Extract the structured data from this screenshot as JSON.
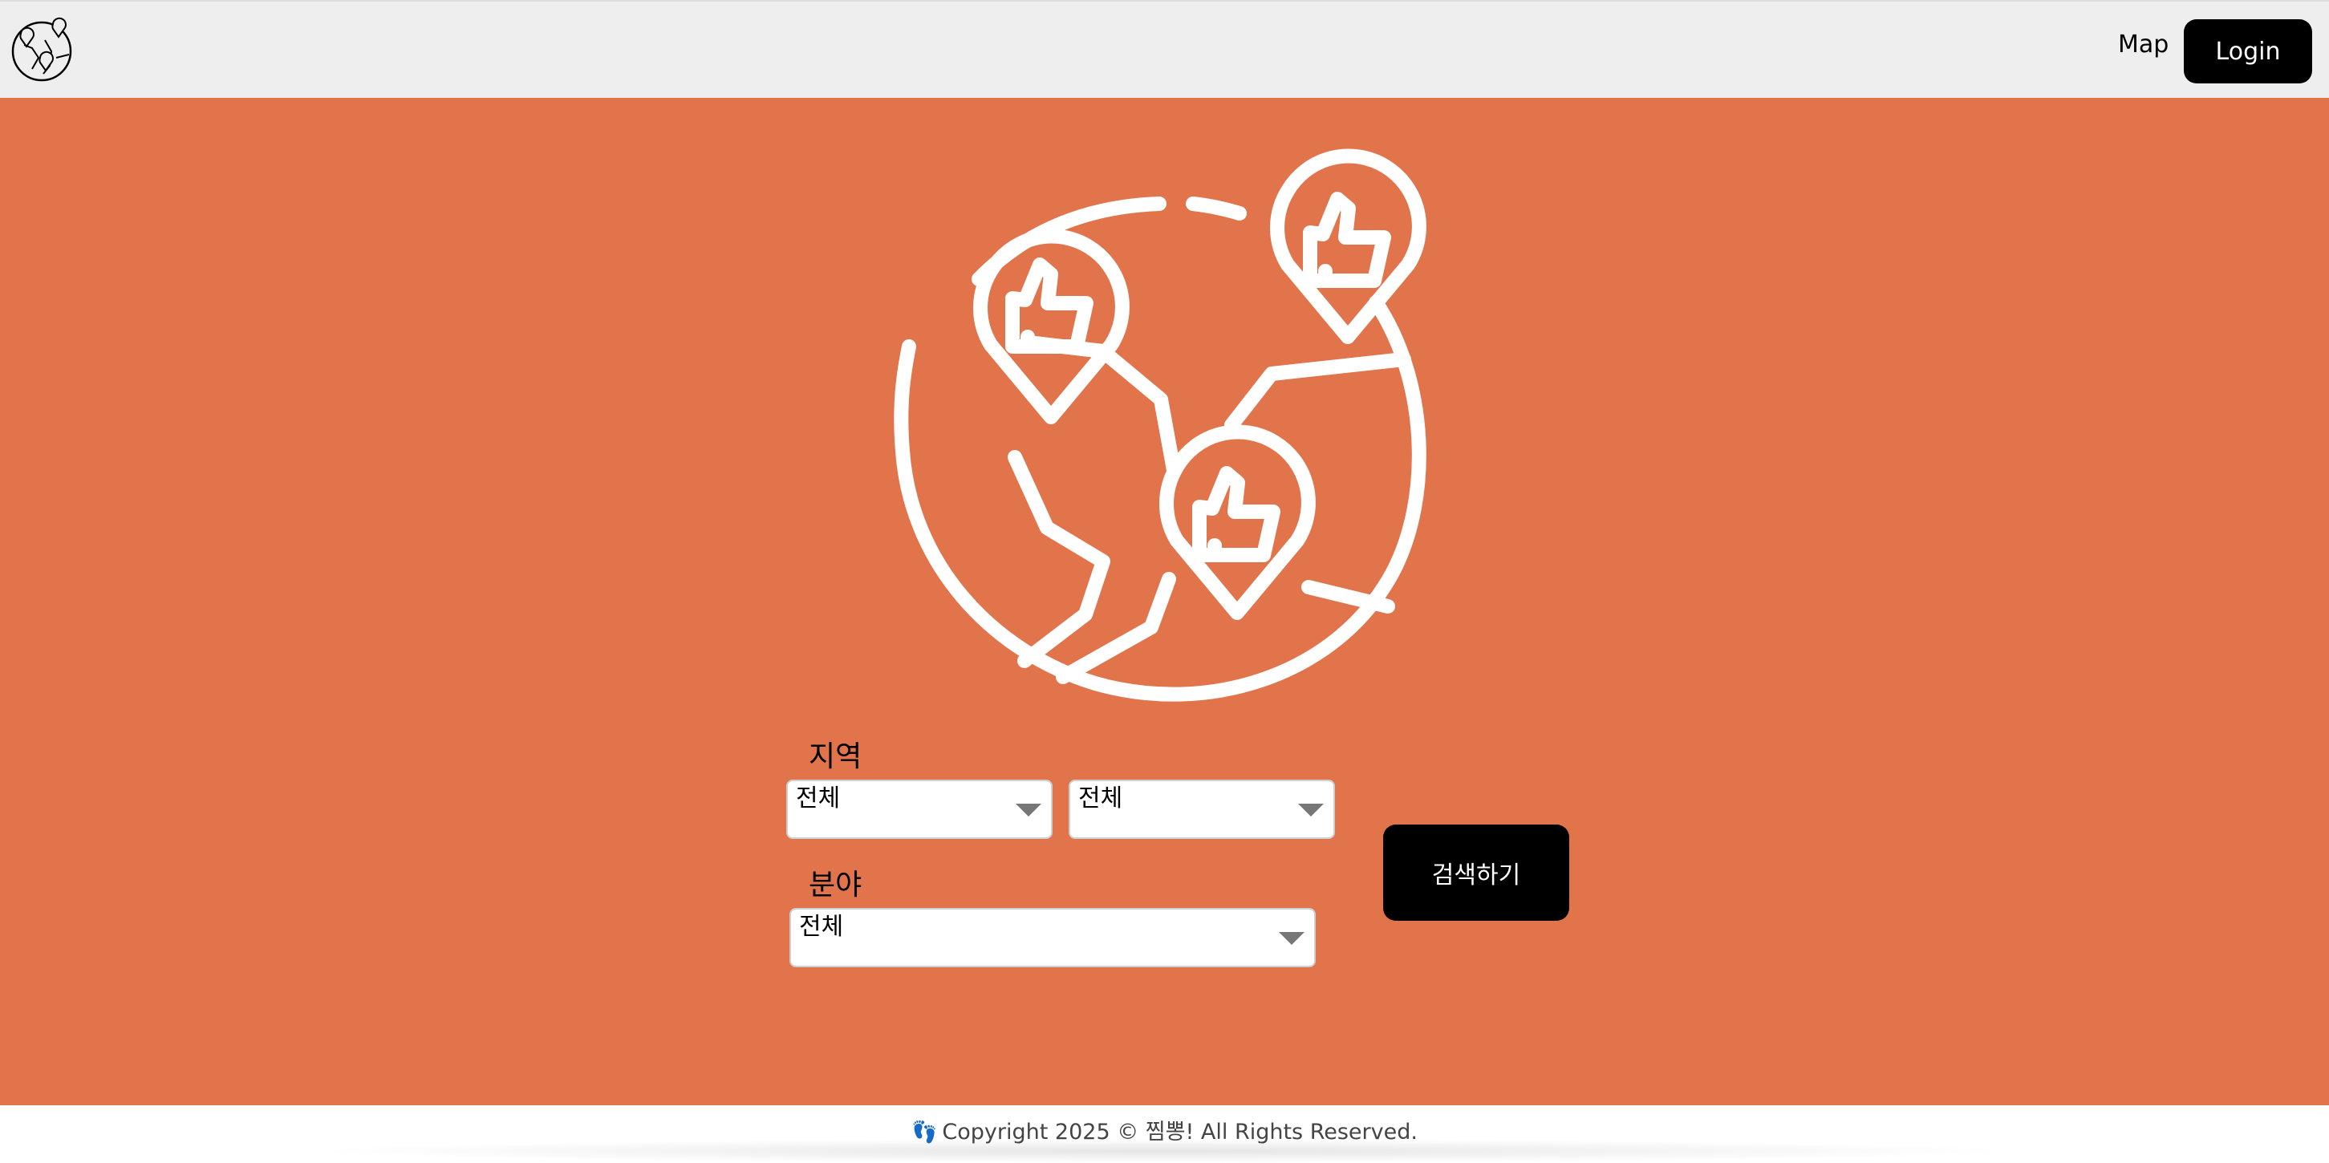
{
  "header": {
    "logo_icon": "globe-pins-logo-icon",
    "nav_map_label": "Map",
    "login_label": "Login"
  },
  "hero": {
    "background_color": "#e2744b",
    "illustration_icon": "globe-thumbs-up-pins-icon"
  },
  "search_form": {
    "region_label": "지역",
    "region_select_1_value": "전체",
    "region_select_2_value": "전체",
    "field_label": "분야",
    "field_select_value": "전체",
    "submit_label": "검색하기"
  },
  "footer": {
    "icon": "footprints-icon",
    "text": "Copyright 2025 © 찜뽕! All Rights Reserved."
  }
}
